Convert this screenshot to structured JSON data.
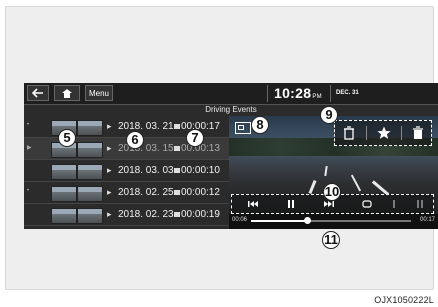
{
  "topbar": {
    "back_icon": "back-arrow-icon",
    "home_icon": "home-icon",
    "menu_label": "Menu",
    "time": "10:28",
    "meridiem": "PM",
    "date": "DEC. 31"
  },
  "screen_title": "Driving Events",
  "events": [
    {
      "date": "2018. 03. 21",
      "duration": "00:00:17",
      "dimmed": false
    },
    {
      "date": "2018. 03. 15",
      "duration": "00:00:13",
      "dimmed": true
    },
    {
      "date": "2018. 03. 03",
      "duration": "00:00:10",
      "dimmed": false
    },
    {
      "date": "2018. 02. 25",
      "duration": "00:00:12",
      "dimmed": false
    },
    {
      "date": "2018. 02. 23",
      "duration": "00:00:19",
      "dimmed": false
    }
  ],
  "player": {
    "time_start": "00:06",
    "time_end": "00:17",
    "progress_fraction": 0.35,
    "actions": [
      "trash-icon",
      "star-icon",
      "delete-icon"
    ],
    "controls": [
      "skip-back-icon",
      "pause-icon",
      "skip-forward-icon",
      "repeat-icon",
      "extra-icon",
      "extra-icon-2"
    ]
  },
  "callouts": [
    "5",
    "6",
    "7",
    "8",
    "9",
    "10",
    "11"
  ],
  "watermark": "OJX1050222L"
}
